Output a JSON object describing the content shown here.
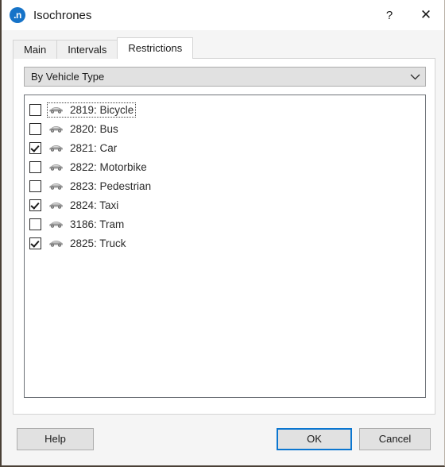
{
  "window": {
    "icon_glyph": ".n",
    "title": "Isochrones",
    "help_button": "?",
    "close_button": "✕"
  },
  "tabs": [
    {
      "label": "Main",
      "active": false
    },
    {
      "label": "Intervals",
      "active": false
    },
    {
      "label": "Restrictions",
      "active": true
    }
  ],
  "restrictions": {
    "filter_combo": {
      "selected": "By Vehicle Type",
      "arrow_icon": "chevron-down-icon"
    },
    "items": [
      {
        "label": "2819: Bicycle",
        "checked": false,
        "focused": true,
        "icon": "vehicle-car-icon"
      },
      {
        "label": "2820: Bus",
        "checked": false,
        "focused": false,
        "icon": "vehicle-car-icon"
      },
      {
        "label": "2821: Car",
        "checked": true,
        "focused": false,
        "icon": "vehicle-car-icon"
      },
      {
        "label": "2822: Motorbike",
        "checked": false,
        "focused": false,
        "icon": "vehicle-car-icon"
      },
      {
        "label": "2823: Pedestrian",
        "checked": false,
        "focused": false,
        "icon": "vehicle-car-icon"
      },
      {
        "label": "2824: Taxi",
        "checked": true,
        "focused": false,
        "icon": "vehicle-car-icon"
      },
      {
        "label": "3186: Tram",
        "checked": false,
        "focused": false,
        "icon": "vehicle-car-icon"
      },
      {
        "label": "2825: Truck",
        "checked": true,
        "focused": false,
        "icon": "vehicle-car-icon"
      }
    ]
  },
  "footer": {
    "help_label": "Help",
    "ok_label": "OK",
    "cancel_label": "Cancel"
  },
  "colors": {
    "accent": "#0b76d0",
    "title_icon_bg": "#1673c8",
    "panel_bg": "#ffffff",
    "dialog_bg": "#f5f5f5",
    "button_bg": "#e1e1e1",
    "listbox_border": "#6e7278"
  }
}
